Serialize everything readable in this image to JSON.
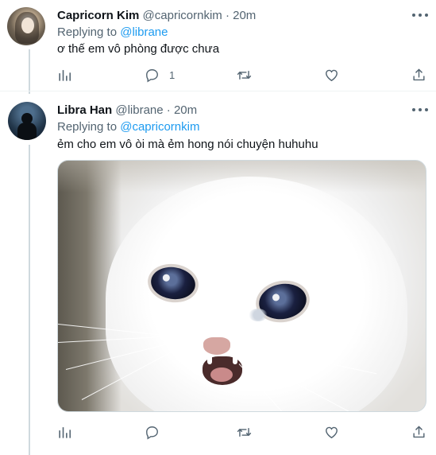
{
  "tweets": [
    {
      "display_name": "Capricorn Kim",
      "handle": "@capricornkim",
      "separator": "·",
      "time": "20m",
      "replying_prefix": "Replying to",
      "replying_to": "@librane",
      "text": "ơ thế em vô phòng được chưa",
      "reply_count": "1"
    },
    {
      "display_name": "Libra Han",
      "handle": "@librane",
      "separator": "·",
      "time": "20m",
      "replying_prefix": "Replying to",
      "replying_to": "@capricornkim",
      "text": "ẻm cho em vô òi mà ẻm hong nói chuyện huhuhu",
      "reply_count": ""
    }
  ],
  "icons": {
    "more": "more-icon",
    "analytics": "analytics-icon",
    "reply": "reply-icon",
    "retweet": "retweet-icon",
    "like": "like-icon",
    "share": "share-icon"
  },
  "colors": {
    "link": "#1d9bf0",
    "secondary_text": "#536471",
    "thread_line": "#cfd9de"
  }
}
